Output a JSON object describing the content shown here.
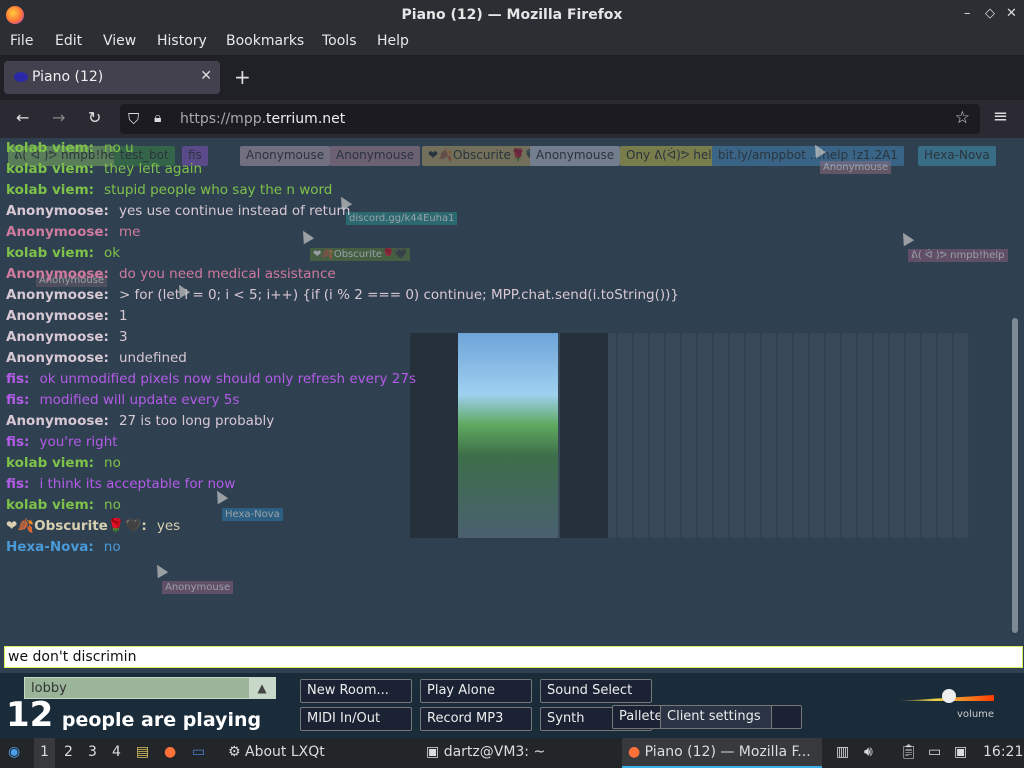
{
  "window": {
    "title": "Piano (12) — Mozilla Firefox",
    "controls": [
      "–",
      "◇",
      "✕"
    ]
  },
  "menubar": [
    "File",
    "Edit",
    "View",
    "History",
    "Bookmarks",
    "Tools",
    "Help"
  ],
  "tab": {
    "label": "Piano (12)",
    "close": "✕",
    "new": "+"
  },
  "nav": {
    "url_prefix": "https://mpp.",
    "url_host": "terrium.net"
  },
  "userlist": [
    {
      "name": "ᕕ( ᐛ )ᕗ nmpb!help",
      "color": "#9ad86a"
    },
    {
      "name": "test_bot",
      "color": "#3d9c3d"
    },
    {
      "name": "fis",
      "color": "#9b59e0"
    },
    {
      "name": "Anonymouse",
      "color": "#d8b8c8"
    },
    {
      "name": "Anonymouse",
      "color": "#c890a8"
    },
    {
      "name": "❤🍂Obscurite🌹🖤",
      "color": "#d8b86a"
    },
    {
      "name": "Anonymouse",
      "color": "#d8d8e8"
    },
    {
      "name": "Ony ᕕ(ᐛ)ᕗ help",
      "color": "#e8d848"
    },
    {
      "name": "bit.ly/amppbot ..!help !z1.2A1",
      "color": "#4a9ad8"
    },
    {
      "name": "Hexa-Nova",
      "color": "#4ab0d8"
    }
  ],
  "chat": [
    {
      "name": "kolab viem:",
      "text": "no u",
      "nc": "#7ec24a",
      "tc": "#7ec24a"
    },
    {
      "name": "kolab viem:",
      "text": "they left again",
      "nc": "#7ec24a",
      "tc": "#7ec24a"
    },
    {
      "name": "kolab viem:",
      "text": "stupid people who say the n word",
      "nc": "#7ec24a",
      "tc": "#7ec24a"
    },
    {
      "name": "Anonymoose:",
      "text": "yes use continue instead of return",
      "nc": "#d8c8d4",
      "tc": "#d8c8d4"
    },
    {
      "name": "Anonymoose:",
      "text": "me",
      "nc": "#d07a9e",
      "tc": "#d07a9e"
    },
    {
      "name": "kolab viem:",
      "text": "ok",
      "nc": "#7ec24a",
      "tc": "#7ec24a"
    },
    {
      "name": "Anonymoose:",
      "text": "do you need medical assistance",
      "nc": "#d07a9e",
      "tc": "#d07a9e"
    },
    {
      "name": "Anonymoose:",
      "text": "> for (let i = 0; i < 5; i++) {if (i % 2 === 0) continue; MPP.chat.send(i.toString())}",
      "nc": "#d8c8d4",
      "tc": "#d8c8d4"
    },
    {
      "name": "Anonymoose:",
      "text": "1",
      "nc": "#d8c8d4",
      "tc": "#d8c8d4"
    },
    {
      "name": "Anonymoose:",
      "text": "3",
      "nc": "#d8c8d4",
      "tc": "#d8c8d4"
    },
    {
      "name": "Anonymoose:",
      "text": "undefined",
      "nc": "#d8c8d4",
      "tc": "#d8c8d4"
    },
    {
      "name": "fis:",
      "text": "ok unmodified pixels now should only refresh every 27s",
      "nc": "#b35ce8",
      "tc": "#b35ce8"
    },
    {
      "name": "fis:",
      "text": "modified will update every 5s",
      "nc": "#b35ce8",
      "tc": "#b35ce8"
    },
    {
      "name": "Anonymoose:",
      "text": "27 is too long probably",
      "nc": "#d8c8d4",
      "tc": "#d8c8d4"
    },
    {
      "name": "fis:",
      "text": "you're right",
      "nc": "#b35ce8",
      "tc": "#b35ce8"
    },
    {
      "name": "kolab viem:",
      "text": "no",
      "nc": "#7ec24a",
      "tc": "#7ec24a"
    },
    {
      "name": "fis:",
      "text": "i think its acceptable for now",
      "nc": "#b35ce8",
      "tc": "#b35ce8"
    },
    {
      "name": "kolab viem:",
      "text": "no",
      "nc": "#7ec24a",
      "tc": "#7ec24a"
    },
    {
      "name": "❤🍂Obscurite🌹🖤:",
      "text": "yes",
      "nc": "#d8d0b0",
      "tc": "#d8d0b0"
    },
    {
      "name": "Hexa-Nova:",
      "text": "no",
      "nc": "#4a9ad8",
      "tc": "#4a9ad8"
    }
  ],
  "input": {
    "value": "we don't discrimin"
  },
  "room": {
    "name": "lobby",
    "arrow": "▲"
  },
  "players": {
    "count": "12",
    "text": "people are playing"
  },
  "buttons": [
    "New Room...",
    "Play Alone",
    "Sound Select",
    "MIDI In/Out",
    "Record MP3",
    "Synth",
    "Pallete",
    "Client settings"
  ],
  "volume": {
    "label": "volume",
    "level": 0.55
  },
  "taskbar": {
    "desktops": [
      "1",
      "2",
      "3",
      "4"
    ],
    "about": "About LXQt",
    "terminal": "dartz@VM3: ~",
    "firefox": "Piano (12) — Mozilla F...",
    "clock": "16:21"
  }
}
